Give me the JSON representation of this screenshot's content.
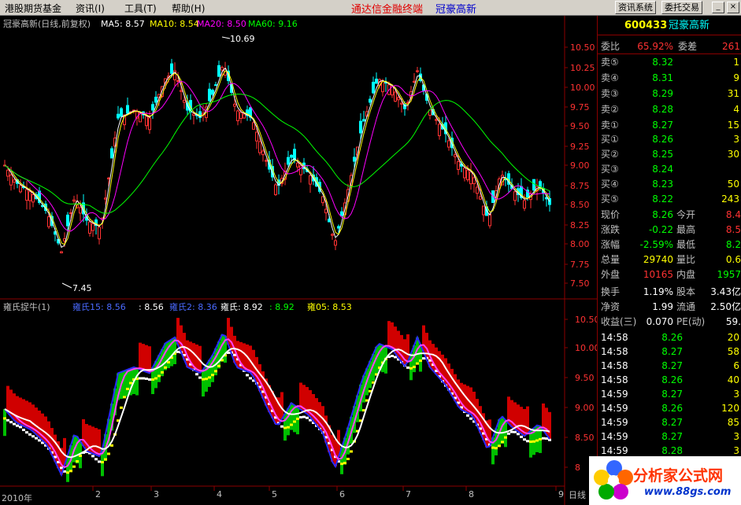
{
  "menu": {
    "items": [
      "港股期货基金",
      "资讯(I)",
      "工具(T)",
      "帮助(H)"
    ],
    "title_left": "通达信金融终端",
    "title_right": "冠豪高新",
    "btn_info": "资讯系统",
    "btn_trade": "委托交易",
    "win_min": "_",
    "win_restore": "□",
    "win_close": "×"
  },
  "colors": {
    "up": "#ff3232",
    "down": "#00ffff",
    "ma5": "#ffffff",
    "ma10": "#ffff00",
    "ma20": "#ff00ff",
    "ma60": "#00ff00",
    "axis": "#8b0000"
  },
  "top_chart": {
    "header_prefix": "冠豪高新(日线,前复权)",
    "ma5_label": "MA5: 8.57",
    "ma10_label": "MA10: 8.54",
    "ma20_label": "MA20: 8.50",
    "ma60_label": "MA60: 9.16",
    "high_marker": "10.69",
    "low_marker": "7.45",
    "yticks": [
      "10.50",
      "10.25",
      "10.00",
      "9.75",
      "9.50",
      "9.25",
      "9.00",
      "8.75",
      "8.50",
      "8.25",
      "8.00",
      "7.75",
      "7.50"
    ]
  },
  "bottom_chart": {
    "header_name": "雍氏捉牛(1)",
    "label1": "雍氏15: 8.56",
    "label2": ": 8.56",
    "label3": "雍氏2: 8.36",
    "label4": "雍氏: 8.92",
    "label5": ": 8.92",
    "label6": "雍05: 8.53",
    "yticks": [
      "10.50",
      "10.00",
      "9.50",
      "9.00",
      "8.50",
      "8"
    ]
  },
  "dates": {
    "year": "2010年",
    "months": [
      "2",
      "3",
      "4",
      "5",
      "6",
      "7",
      "8",
      "9"
    ],
    "suffix": "日线"
  },
  "panel": {
    "code": "600433",
    "name": "冠豪高新",
    "weibi_label": "委比",
    "weibi_value": "65.92%",
    "weicha_label": "委差",
    "weicha_value": "261",
    "sells": [
      {
        "label": "卖⑤",
        "price": "8.32",
        "vol": "1"
      },
      {
        "label": "卖④",
        "price": "8.31",
        "vol": "9"
      },
      {
        "label": "卖③",
        "price": "8.29",
        "vol": "31"
      },
      {
        "label": "卖②",
        "price": "8.28",
        "vol": "4"
      },
      {
        "label": "卖①",
        "price": "8.27",
        "vol": "15"
      }
    ],
    "buys": [
      {
        "label": "买①",
        "price": "8.26",
        "vol": "3"
      },
      {
        "label": "买②",
        "price": "8.25",
        "vol": "30"
      },
      {
        "label": "买③",
        "price": "8.24",
        "vol": ""
      },
      {
        "label": "买④",
        "price": "8.23",
        "vol": "50"
      },
      {
        "label": "买⑤",
        "price": "8.22",
        "vol": "243"
      }
    ],
    "stats": [
      {
        "l1": "现价",
        "v1": "8.26",
        "l2": "今开",
        "v2": "8.4"
      },
      {
        "l1": "涨跌",
        "v1": "-0.22",
        "l2": "最高",
        "v2": "8.5"
      },
      {
        "l1": "涨幅",
        "v1": "-2.59%",
        "l2": "最低",
        "v2": "8.2"
      },
      {
        "l1": "总量",
        "v1": "29740",
        "l2": "量比",
        "v2": "0.6"
      },
      {
        "l1": "外盘",
        "v1": "10165",
        "l2": "内盘",
        "v2": "1957"
      }
    ],
    "stats2": [
      {
        "l1": "换手",
        "v1": "1.19%",
        "l2": "股本",
        "v2": "3.43亿"
      },
      {
        "l1": "净资",
        "v1": "1.99",
        "l2": "流通",
        "v2": "2.50亿"
      },
      {
        "l1": "收益(三)",
        "v1": "0.070",
        "l2": "PE(动)",
        "v2": "59."
      }
    ],
    "ticks": [
      {
        "time": "14:58",
        "price": "8.26",
        "vol": "20"
      },
      {
        "time": "14:58",
        "price": "8.27",
        "vol": "58"
      },
      {
        "time": "14:58",
        "price": "8.27",
        "vol": "6"
      },
      {
        "time": "14:58",
        "price": "8.26",
        "vol": "40"
      },
      {
        "time": "14:59",
        "price": "8.27",
        "vol": "3"
      },
      {
        "time": "14:59",
        "price": "8.26",
        "vol": "120"
      },
      {
        "time": "14:59",
        "price": "8.27",
        "vol": "85"
      },
      {
        "time": "14:59",
        "price": "8.27",
        "vol": "3"
      },
      {
        "time": "14:59",
        "price": "8.28",
        "vol": "3"
      }
    ]
  },
  "watermark": {
    "title": "分析家公式网",
    "url": "www.88gs.com"
  }
}
